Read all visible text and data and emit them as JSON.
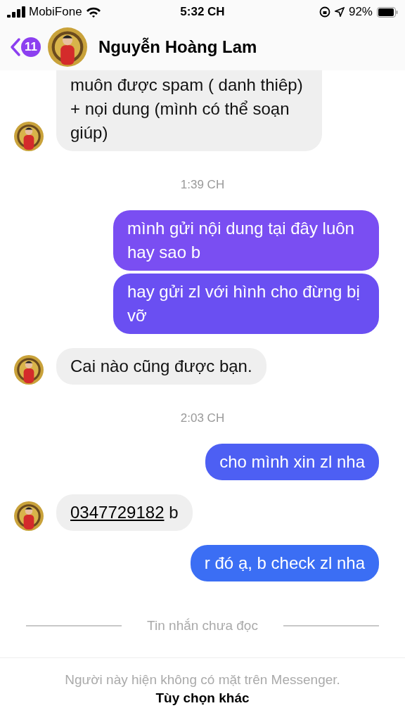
{
  "status_bar": {
    "carrier": "MobiFone",
    "time": "5:32 CH",
    "battery": "92%"
  },
  "header": {
    "back_count": "11",
    "name": "Nguyễn Hoàng Lam"
  },
  "messages": [
    {
      "kind": "incoming",
      "text": "muôn được spam ( danh thiêp) + nọi dung (mình có thể soạn giúp)",
      "cut_top": true
    },
    {
      "kind": "time",
      "text": "1:39 CH"
    },
    {
      "kind": "outgoing",
      "text": "mình gửi nội dung tại đây luôn hay sao b",
      "color": "#7a4ef2"
    },
    {
      "kind": "outgoing",
      "text": "hay gửi zl với hình cho đừng bị vỡ",
      "color": "#6a4ff2"
    },
    {
      "kind": "incoming",
      "text": "Cai nào cũng được bạn."
    },
    {
      "kind": "time",
      "text": "2:03 CH"
    },
    {
      "kind": "outgoing",
      "text": "cho mình xin zl nha",
      "color": "#4d5ff3"
    },
    {
      "kind": "incoming",
      "link": "0347729182",
      "text": " b"
    },
    {
      "kind": "outgoing",
      "text": "r đó ạ, b check zl nha",
      "color": "#3b6ef4"
    },
    {
      "kind": "divider",
      "text": "Tin nhắn chưa đọc"
    }
  ],
  "footer": {
    "text": "Người này hiện không có mặt trên Messenger.",
    "link": "Tùy chọn khác"
  }
}
